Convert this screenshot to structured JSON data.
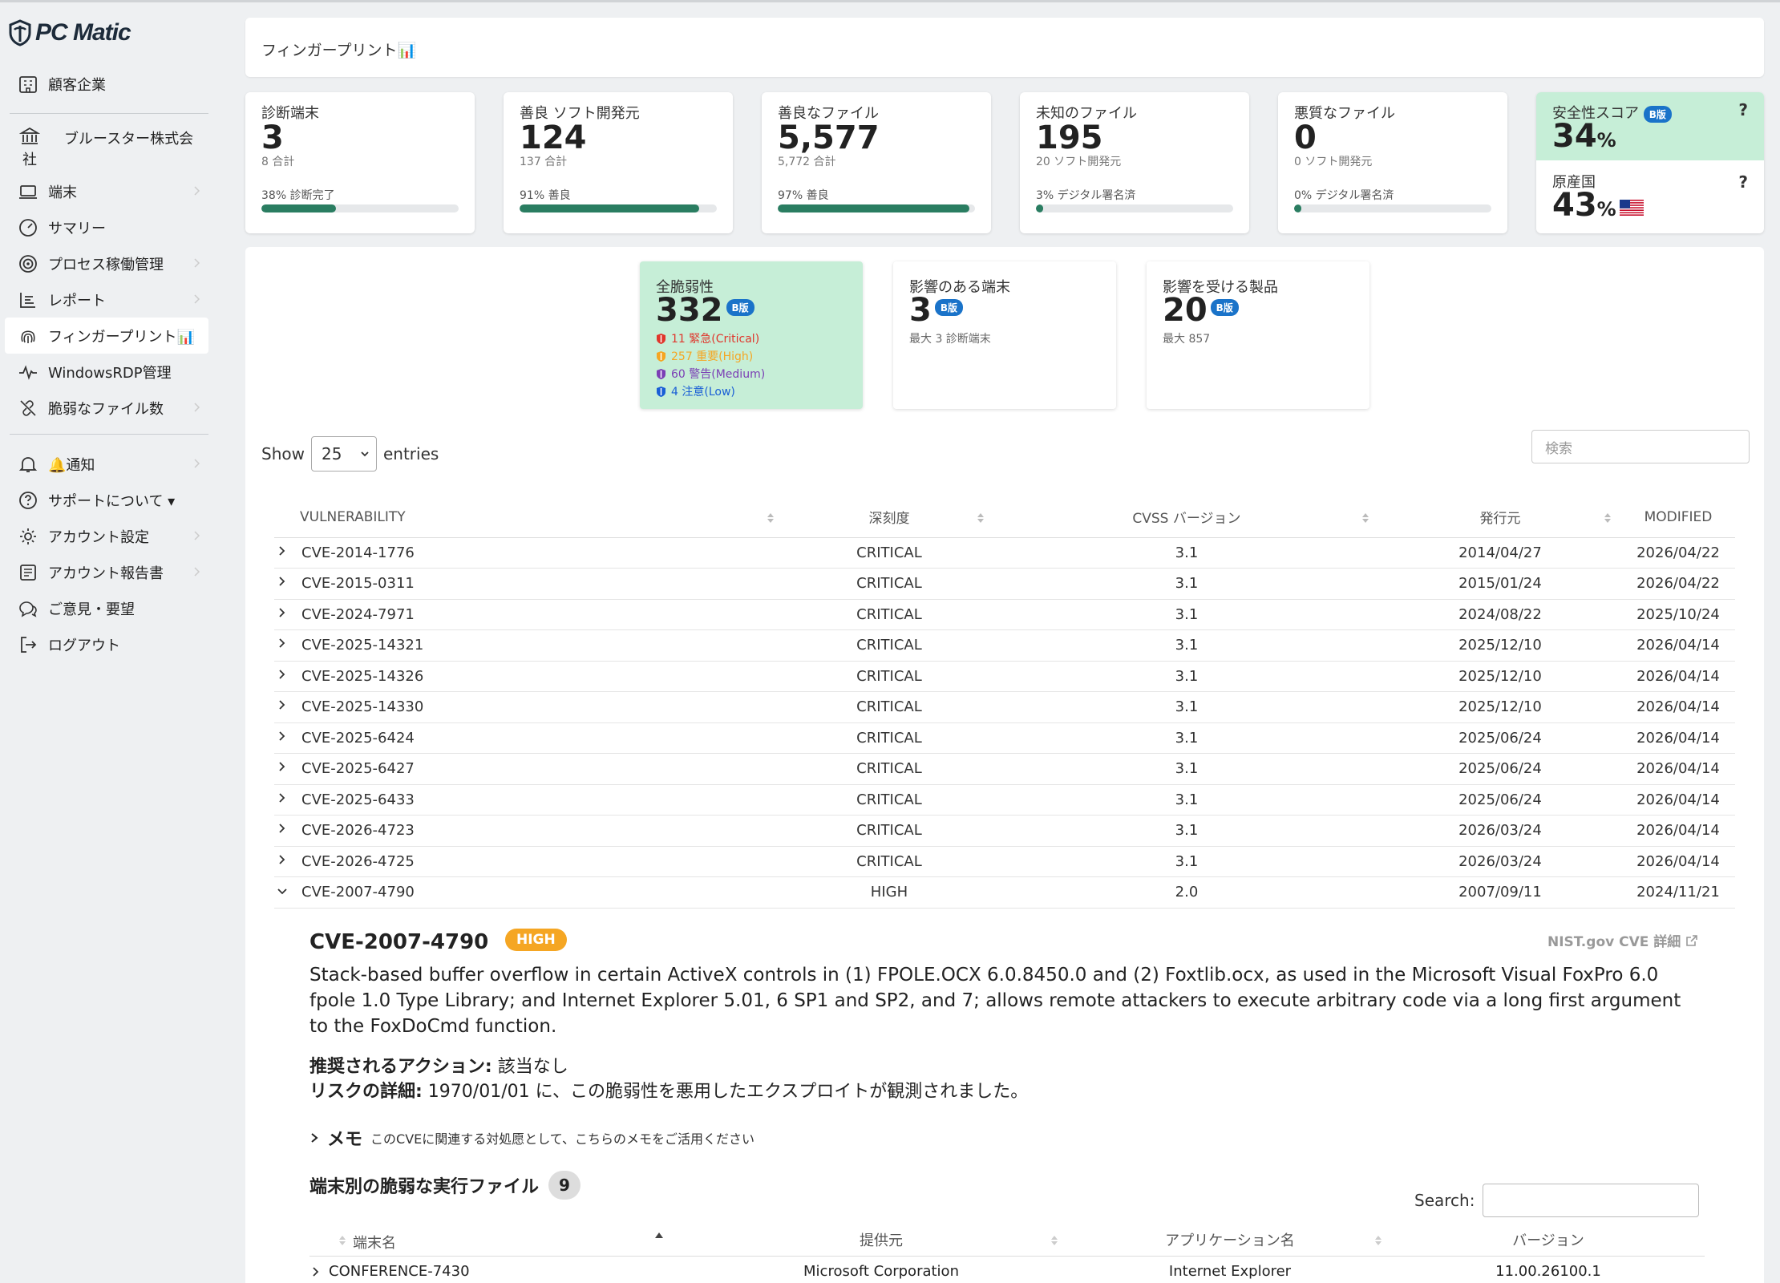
{
  "brand": {
    "logo_text": "PC Matic"
  },
  "sidebar": {
    "customers": "顧客企業",
    "company_line1": "ブルースター株式会",
    "company_line2": "社",
    "items": [
      {
        "label": "端末"
      },
      {
        "label": "サマリー"
      },
      {
        "label": "プロセス稼働管理"
      },
      {
        "label": "レポート"
      },
      {
        "label": "フィンガープリント📊"
      },
      {
        "label": "WindowsRDP管理"
      },
      {
        "label": "脆弱なファイル数"
      },
      {
        "label": "🔔通知"
      },
      {
        "label": "サポートについて ▾"
      },
      {
        "label": "アカウント設定"
      },
      {
        "label": "アカウント報告書"
      },
      {
        "label": "ご意見・要望"
      },
      {
        "label": "ログアウト"
      }
    ]
  },
  "header": {
    "title": "フィンガープリント📊"
  },
  "stats": [
    {
      "label": "診断端末",
      "value": "3",
      "sub": "8 合計",
      "progress_label": "38% 診断完了",
      "progress": 0.38
    },
    {
      "label": "善良 ソフト開発元",
      "value": "124",
      "sub": "137 合計",
      "progress_label": "91% 善良",
      "progress": 0.91
    },
    {
      "label": "善良なファイル",
      "value": "5,577",
      "sub": "5,772 合計",
      "progress_label": "97% 善良",
      "progress": 0.97
    },
    {
      "label": "未知のファイル",
      "value": "195",
      "sub": "20 ソフト開発元",
      "progress_label": "3% デジタル署名済",
      "progress": 0.03
    },
    {
      "label": "悪質なファイル",
      "value": "0",
      "sub": "0 ソフト開発元",
      "progress_label": "0% デジタル署名済",
      "progress": 0.0
    }
  ],
  "score": {
    "safety_label": "安全性スコア",
    "safety_value": "34",
    "origin_label": "原産国",
    "origin_value": "43",
    "pct": "%",
    "badge": "B版",
    "help": "?"
  },
  "vuln_cards": {
    "total": {
      "label": "全脆弱性",
      "value": "332",
      "badge": "B版",
      "severities": [
        {
          "text": "11 緊急(Critical)",
          "color": "#e0362c"
        },
        {
          "text": "257 重要(High)",
          "color": "#f5a623"
        },
        {
          "text": "60 警告(Medium)",
          "color": "#7b3fb5"
        },
        {
          "text": "4 注意(Low)",
          "color": "#1a5fd6"
        }
      ]
    },
    "endpoints": {
      "label": "影響のある端末",
      "value": "3",
      "badge": "B版",
      "sub": "最大 3 診断端末"
    },
    "products": {
      "label": "影響を受ける製品",
      "value": "20",
      "badge": "B版",
      "sub": "最大 857"
    }
  },
  "table_controls": {
    "show": "Show",
    "entries": "entries",
    "page_size": "25",
    "search_placeholder": "検索"
  },
  "table": {
    "headers": [
      "VULNERABILITY",
      "深刻度",
      "CVSS バージョン",
      "発行元",
      "MODIFIED"
    ],
    "rows": [
      [
        "CVE-2014-1776",
        "CRITICAL",
        "3.1",
        "2014/04/27",
        "2026/04/22"
      ],
      [
        "CVE-2015-0311",
        "CRITICAL",
        "3.1",
        "2015/01/24",
        "2026/04/22"
      ],
      [
        "CVE-2024-7971",
        "CRITICAL",
        "3.1",
        "2024/08/22",
        "2025/10/24"
      ],
      [
        "CVE-2025-14321",
        "CRITICAL",
        "3.1",
        "2025/12/10",
        "2026/04/14"
      ],
      [
        "CVE-2025-14326",
        "CRITICAL",
        "3.1",
        "2025/12/10",
        "2026/04/14"
      ],
      [
        "CVE-2025-14330",
        "CRITICAL",
        "3.1",
        "2025/12/10",
        "2026/04/14"
      ],
      [
        "CVE-2025-6424",
        "CRITICAL",
        "3.1",
        "2025/06/24",
        "2026/04/14"
      ],
      [
        "CVE-2025-6427",
        "CRITICAL",
        "3.1",
        "2025/06/24",
        "2026/04/14"
      ],
      [
        "CVE-2025-6433",
        "CRITICAL",
        "3.1",
        "2025/06/24",
        "2026/04/14"
      ],
      [
        "CVE-2026-4723",
        "CRITICAL",
        "3.1",
        "2026/03/24",
        "2026/04/14"
      ],
      [
        "CVE-2026-4725",
        "CRITICAL",
        "3.1",
        "2026/03/24",
        "2026/04/14"
      ],
      [
        "CVE-2007-4790",
        "HIGH",
        "2.0",
        "2007/09/11",
        "2024/11/21"
      ]
    ]
  },
  "detail": {
    "cve": "CVE-2007-4790",
    "severity": "HIGH",
    "nist_link": "NIST.gov CVE 詳細",
    "description": "Stack-based buffer overflow in certain ActiveX controls in (1) FPOLE.OCX 6.0.8450.0 and (2) Foxtlib.ocx, as used in the Microsoft Visual FoxPro 6.0 fpole 1.0 Type Library; and Internet Explorer 5.01, 6 SP1 and SP2, and 7; allows remote attackers to execute arbitrary code via a long first argument to the FoxDoCmd function.",
    "action_label": "推奨されるアクション:",
    "action_value": " 該当なし",
    "risk_label": "リスクの詳細:",
    "risk_value": " 1970/01/01 に、この脆弱性を悪用したエクスプロイトが観測されました。",
    "memo_label": "メモ",
    "memo_text": "このCVEに関連する対処愿として、こちらのメモをご活用ください",
    "exec_title": "端末別の脆弱な実行ファイル",
    "exec_count": "9",
    "search_label": "Search:",
    "exec_headers": [
      "端末名",
      "提供元",
      "アプリケーション名",
      "バージョン"
    ],
    "exec_rows": [
      [
        "CONFERENCE-7430",
        "Microsoft Corporation",
        "Internet Explorer",
        "11.00.26100.1"
      ]
    ]
  }
}
